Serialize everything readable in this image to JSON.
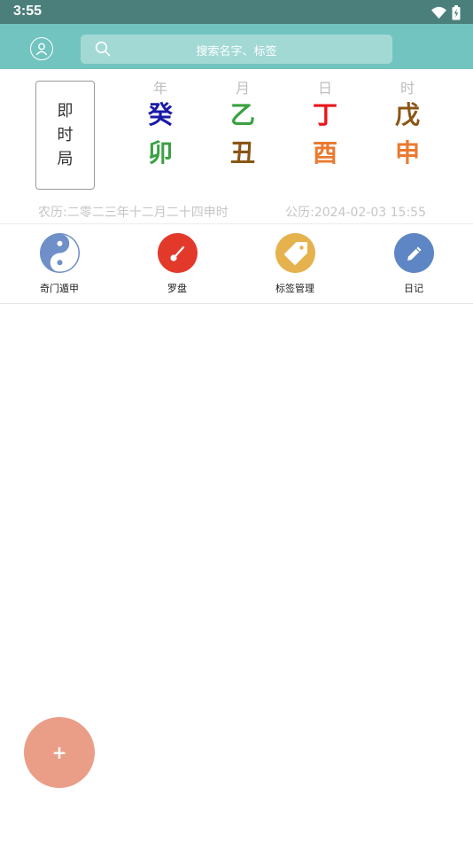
{
  "status": {
    "time": "3:55"
  },
  "header": {
    "search_placeholder": "搜索名字、标签"
  },
  "instant_chart": {
    "chars": [
      "即",
      "时",
      "局"
    ]
  },
  "pillars": [
    {
      "label": "年",
      "stem": "癸",
      "stem_color": "#1a1aa6",
      "branch": "卯",
      "branch_color": "#3aa142"
    },
    {
      "label": "月",
      "stem": "乙",
      "stem_color": "#3aa142",
      "branch": "丑",
      "branch_color": "#8a5515"
    },
    {
      "label": "日",
      "stem": "丁",
      "stem_color": "#e8151b",
      "branch": "酉",
      "branch_color": "#ea7a2f"
    },
    {
      "label": "时",
      "stem": "戊",
      "stem_color": "#8a5515",
      "branch": "申",
      "branch_color": "#ea7a2f"
    }
  ],
  "dates": {
    "lunar": "农历:二零二三年十二月二十四申时",
    "solar": "公历:2024-02-03 15:55"
  },
  "functions": [
    {
      "label": "奇门遁甲",
      "icon": "yin-yang-icon",
      "color": "#6f8fc8"
    },
    {
      "label": "罗盘",
      "icon": "compass-icon",
      "color": "#e3392a"
    },
    {
      "label": "标签管理",
      "icon": "tag-icon",
      "color": "#e6b24e"
    },
    {
      "label": "日记",
      "icon": "pencil-icon",
      "color": "#5f86c4"
    }
  ],
  "fab": {
    "label": "+",
    "color": "#ea9e88"
  },
  "colors": {
    "status_bar": "#4a7f7b",
    "header": "#72c4c0",
    "search_box": "#a2d9d5"
  }
}
